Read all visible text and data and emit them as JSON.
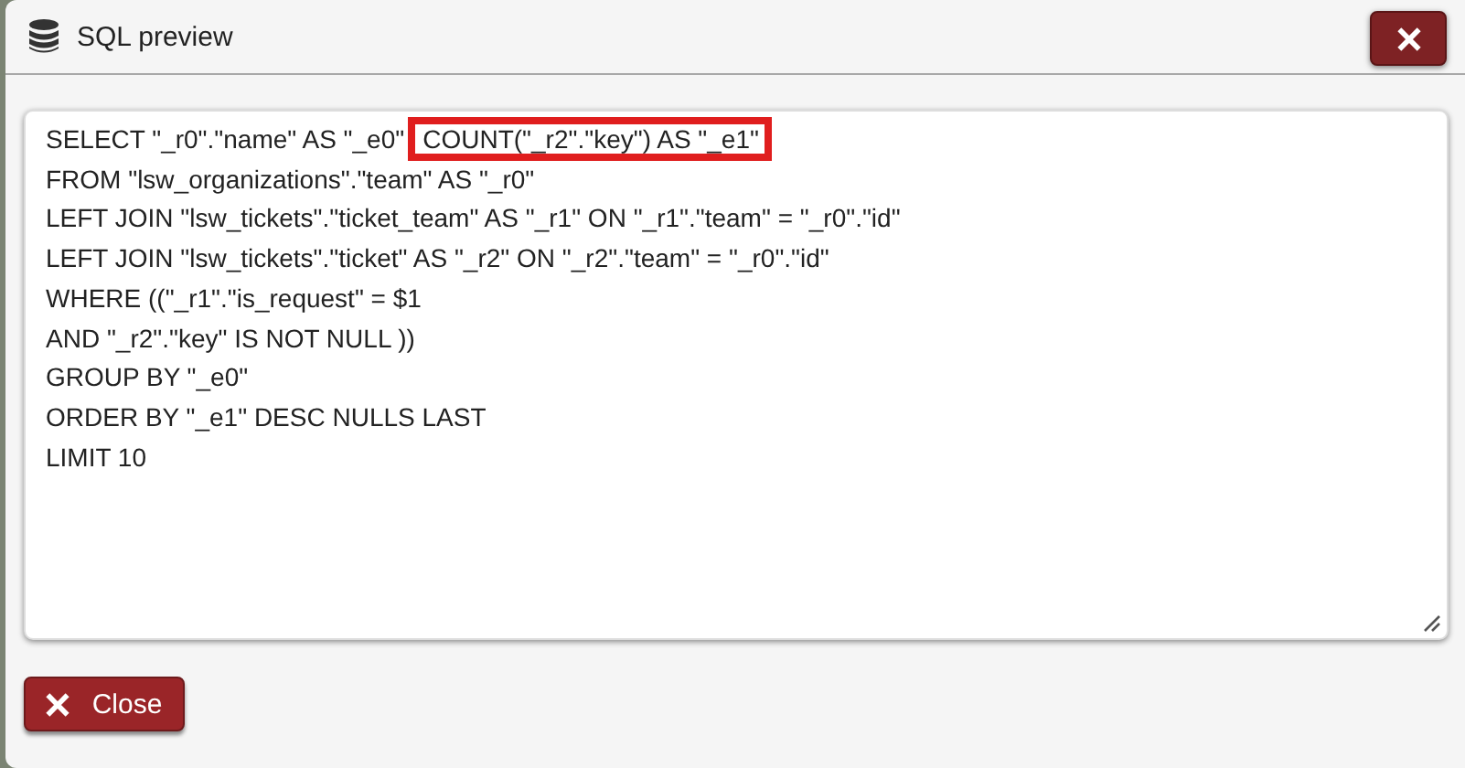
{
  "dialog": {
    "title": "SQL preview"
  },
  "query": {
    "lines": [
      [
        {
          "text": "SELECT \"_r0\".\"name\" AS \"_e0\"",
          "highlighted": false
        },
        {
          "text": "COUNT(\"_r2\".\"key\") AS \"_e1\"",
          "highlighted": true
        }
      ],
      [
        {
          "text": "FROM \"lsw_organizations\".\"team\" AS \"_r0\"",
          "highlighted": false
        }
      ],
      [
        {
          "text": "LEFT JOIN \"lsw_tickets\".\"ticket_team\" AS \"_r1\" ON \"_r1\".\"team\" = \"_r0\".\"id\"",
          "highlighted": false
        }
      ],
      [
        {
          "text": "LEFT JOIN \"lsw_tickets\".\"ticket\" AS \"_r2\" ON \"_r2\".\"team\" = \"_r0\".\"id\"",
          "highlighted": false
        }
      ],
      [
        {
          "text": "WHERE ((\"_r1\".\"is_request\" = $1",
          "highlighted": false
        }
      ],
      [
        {
          "text": "AND \"_r2\".\"key\" IS NOT NULL ))",
          "highlighted": false
        }
      ],
      [
        {
          "text": "GROUP BY \"_e0\"",
          "highlighted": false
        }
      ],
      [
        {
          "text": "ORDER BY \"_e1\" DESC NULLS LAST",
          "highlighted": false
        }
      ],
      [
        {
          "text": "LIMIT 10",
          "highlighted": false
        }
      ]
    ]
  },
  "buttons": [
    {
      "label": "Close"
    }
  ]
}
